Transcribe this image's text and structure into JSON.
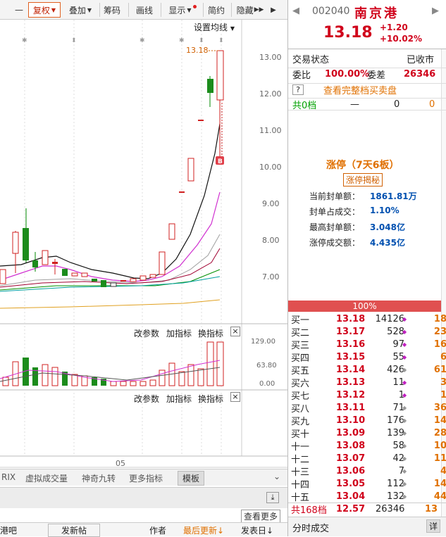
{
  "toolbar": {
    "minus": "—",
    "fuquan": "复权",
    "diejia": "叠加",
    "chouma": "筹码",
    "huaxian": "画线",
    "xianshi": "显示",
    "jianyue": "简约",
    "yincang": "隐藏"
  },
  "chart": {
    "settings": "设置均线",
    "price_marker": "13.18",
    "b_marker": "B",
    "yaxis": [
      "13.00",
      "12.00",
      "11.00",
      "10.00",
      "9.00",
      "8.00",
      "7.00"
    ],
    "ind_labels": {
      "gaican": "改参数",
      "jia": "加指标",
      "huan": "换指标"
    },
    "vol_axis": [
      "129.00",
      "63.80",
      "0.00"
    ],
    "date_label": "05",
    "close_x": "×"
  },
  "bottom_tabs": [
    "RIX",
    "虚拟成交量",
    "神奇九转",
    "更多指标",
    "模板"
  ],
  "footer": {
    "view_more": "查看更多",
    "forum": "港吧",
    "post": "发新帖",
    "author": "作者",
    "latest": "最后更新",
    "poster": "发表日"
  },
  "quote": {
    "code": "002040",
    "name": "南京港",
    "price": "13.18",
    "change": "+1.20",
    "pct": "+10.02%",
    "state_label": "交易状态",
    "state_value": "已收市",
    "weibi_label": "委比",
    "weibi_value": "100.00%",
    "weicha_label": "委差",
    "weicha_value": "26346",
    "help": "?",
    "full_depth": "查看完整档买卖盘",
    "gong0": "共0档",
    "dash": "—",
    "zero1": "0",
    "zero2": "0",
    "limit_title": "涨停（7天6板）",
    "limit_btn": "涨停揭秘",
    "stats": [
      {
        "label": "当前封单额：",
        "value": "1861.81万"
      },
      {
        "label": "封单占成交：",
        "value": "1.10%"
      },
      {
        "label": "最高封单额：",
        "value": "3.048亿"
      },
      {
        "label": "涨停成交额：",
        "value": "4.435亿"
      }
    ],
    "bar_pct": "100%",
    "bids": [
      {
        "n": "买一",
        "p": "13.18",
        "v": "14126",
        "c": "18"
      },
      {
        "n": "买二",
        "p": "13.17",
        "v": "528",
        "c": "23"
      },
      {
        "n": "买三",
        "p": "13.16",
        "v": "97",
        "c": "16"
      },
      {
        "n": "买四",
        "p": "13.15",
        "v": "55",
        "c": "6"
      },
      {
        "n": "买五",
        "p": "13.14",
        "v": "426",
        "c": "61"
      },
      {
        "n": "买六",
        "p": "13.13",
        "v": "11",
        "c": "3"
      },
      {
        "n": "买七",
        "p": "13.12",
        "v": "1",
        "c": "1"
      },
      {
        "n": "买八",
        "p": "13.11",
        "v": "71",
        "c": "36"
      },
      {
        "n": "买九",
        "p": "13.10",
        "v": "176",
        "c": "14"
      },
      {
        "n": "买十",
        "p": "13.09",
        "v": "139",
        "c": "28"
      },
      {
        "n": "十一",
        "p": "13.08",
        "v": "58",
        "c": "10"
      },
      {
        "n": "十二",
        "p": "13.07",
        "v": "42",
        "c": "11"
      },
      {
        "n": "十三",
        "p": "13.06",
        "v": "7",
        "c": "4"
      },
      {
        "n": "十四",
        "p": "13.05",
        "v": "112",
        "c": "14"
      },
      {
        "n": "十五",
        "p": "13.04",
        "v": "132",
        "c": "44"
      }
    ],
    "total": {
      "n": "共168档",
      "p": "12.57",
      "v": "26346",
      "c": "13"
    },
    "fenshi": "分时成交",
    "xiang": "详"
  }
}
